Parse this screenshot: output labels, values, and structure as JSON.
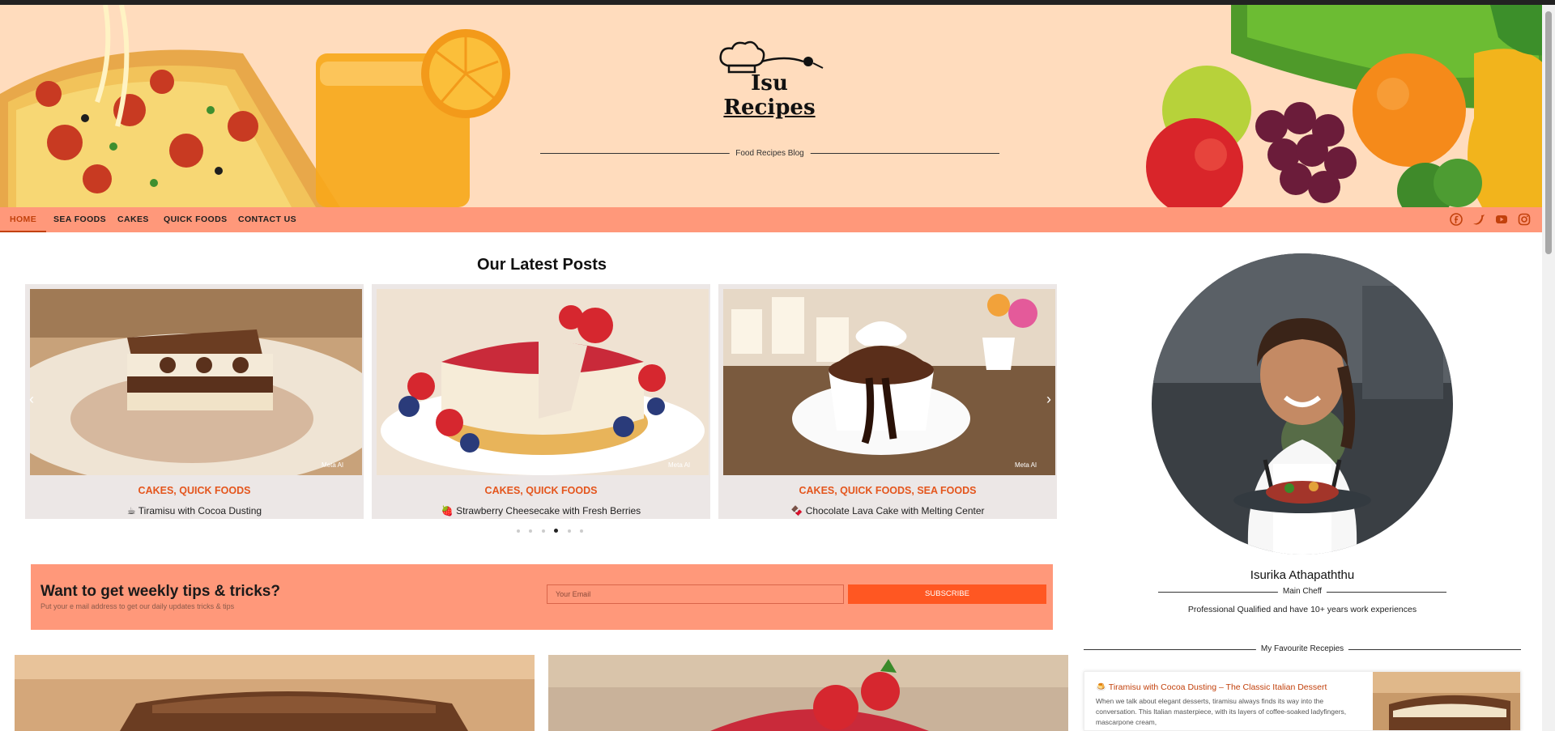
{
  "header": {
    "logo_line1": "Isu",
    "logo_line2": "Recipes",
    "tagline": "Food Recipes Blog"
  },
  "nav": {
    "items": [
      "HOME",
      "SEA FOODS",
      "CAKES",
      "QUICK FOODS",
      "CONTACT US"
    ],
    "active_index": 0,
    "social_icons": [
      "facebook-icon",
      "twitter-icon",
      "youtube-icon",
      "instagram-icon"
    ]
  },
  "latest": {
    "title": "Our Latest Posts",
    "cards": [
      {
        "category": "CAKES, QUICK FOODS",
        "title": "☕ Tiramisu with Cocoa Dusting"
      },
      {
        "category": "CAKES, QUICK FOODS",
        "title": "🍓 Strawberry Cheesecake with Fresh Berries"
      },
      {
        "category": "CAKES, QUICK FOODS, SEA FOODS",
        "title": "🍫 Chocolate Lava Cake with Melting Center"
      }
    ],
    "watermark": "Meta AI",
    "dots_count": 6,
    "active_dot": 3
  },
  "subscribe": {
    "title": "Want to get weekly tips & tricks?",
    "subtitle": "Put your e mail address to get our daily updates tricks & tips",
    "placeholder": "Your Email",
    "button": "SUBSCRIBE"
  },
  "chef": {
    "name": "Isurika Athapaththu",
    "role": "Main Cheff",
    "description": "Professional  Qualified and have 10+ years work experiences"
  },
  "favourites": {
    "heading": "My Favourite Recepies",
    "item_title": "🍮 Tiramisu with Cocoa Dusting – The Classic Italian Dessert",
    "item_text": "When we talk about elegant desserts, tiramisu always finds its way into the conversation. This Italian masterpiece, with its layers of coffee-soaked ladyfingers, mascarpone cream,"
  },
  "colors": {
    "header_bg": "#ffdcbd",
    "nav_bg": "#ff987a",
    "accent": "#e4551c",
    "button": "#ff5722"
  }
}
